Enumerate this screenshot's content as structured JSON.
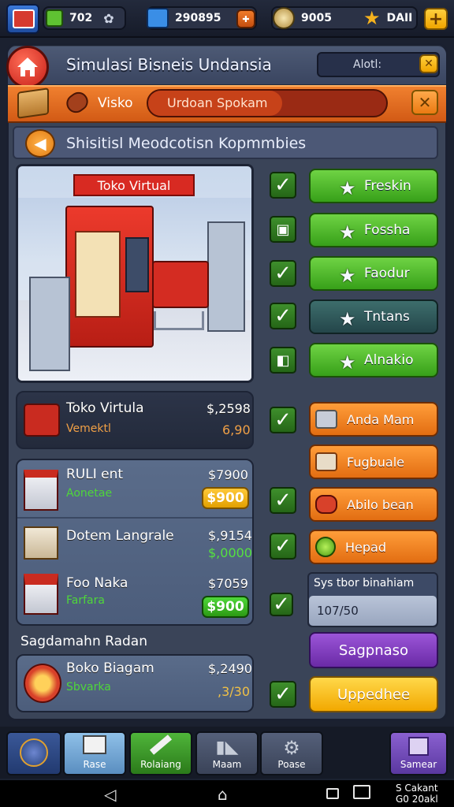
{
  "topbar": {
    "res1": "702",
    "res2": "290895",
    "res3": "9005",
    "res4": "DAII",
    "plus_label": "+"
  },
  "header": {
    "title": "Simulasi Bisneis Undansia",
    "alert_label": "Alotl:",
    "close_label": "✕"
  },
  "orangebar": {
    "tab_label": "Visko",
    "field_value": "Urdoan Spokam",
    "close_label": "✕"
  },
  "subtitle": "Shisitisl Meodcotisn Kopmmbies",
  "illustration": {
    "sign": "Toko Virtual"
  },
  "green_buttons": [
    {
      "label": "Freskin",
      "style": "green"
    },
    {
      "label": "Fossha",
      "style": "green"
    },
    {
      "label": "Faodur",
      "style": "green"
    },
    {
      "label": "Tntans",
      "style": "dark"
    },
    {
      "label": "Alnakio",
      "style": "green"
    }
  ],
  "orange_buttons": [
    {
      "label": "Anda Mam"
    },
    {
      "label": "Fugbuale"
    },
    {
      "label": "Abilo bean"
    },
    {
      "label": "Hepad"
    }
  ],
  "items": [
    {
      "name": "Toko Virtula",
      "sub": "Vemektl",
      "price": "$,2598",
      "value": "6,90"
    },
    {
      "name": "RULI ent",
      "sub": "Aonetae",
      "price": "$7900",
      "value": "$900"
    },
    {
      "name": "Dotem Langrale",
      "sub": "",
      "price": "$,9154",
      "value": "$,0000"
    },
    {
      "name": "Foo Naka",
      "sub": "Farfara",
      "price": "$7059",
      "value": "$900"
    }
  ],
  "section2_title": "Sagdamahn Radan",
  "item5": {
    "name": "Boko Biagam",
    "sub": "Sbvarka",
    "price": "$,2490",
    "value": ",3/30"
  },
  "stats": {
    "label": "Sys tbor binahiam",
    "value": "107/50"
  },
  "purple_button": "Sagpnaso",
  "yellow_button": "Uppedhee",
  "nav": [
    {
      "label": ""
    },
    {
      "label": "Rase"
    },
    {
      "label": "Rolaiang"
    },
    {
      "label": "Maam"
    },
    {
      "label": "Poase"
    },
    {
      "label": "Samear"
    }
  ],
  "system": {
    "status1": "S Cakant",
    "status2": "G0 20akl"
  },
  "colors": {
    "green": "#37a019",
    "orange": "#e26d12",
    "panel": "#3a4458",
    "accent_red": "#c61f18"
  }
}
